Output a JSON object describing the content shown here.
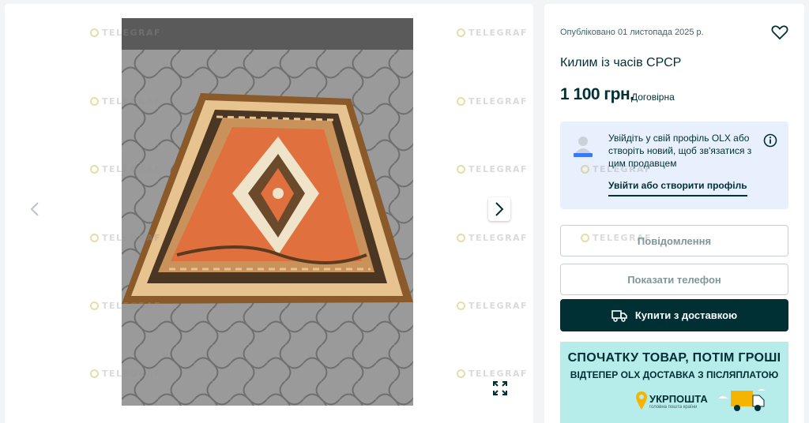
{
  "gallery": {
    "image_alt": "carpet photo",
    "prev_icon": "chevron-left-icon",
    "next_icon": "chevron-right-icon",
    "fullscreen_icon": "expand-icon",
    "watermark": "TELEGRAF"
  },
  "listing": {
    "published": "Опубліковано 01 листопада 2025 р.",
    "title": "Килим із часів СРСР",
    "price": "1 100 грн.",
    "negotiable": "Договірна",
    "favorite_icon": "heart-icon"
  },
  "login_prompt": {
    "text": "Увійдіть у свій профіль OLX або створіть новий, щоб зв'язатися з цим продавцем",
    "link": "Увійти або створити профіль",
    "info_icon": "info-icon"
  },
  "actions": {
    "message": "Повідомлення",
    "show_phone": "Показати телефон",
    "buy_delivery": "Купити з доставкою",
    "buy_icon": "truck-icon"
  },
  "banner": {
    "headline": "СПОЧАТКУ ТОВАР, ПОТІМ ГРОШІ",
    "subline": "ВІДТЕПЕР OLX ДОСТАВКА З ПІСЛЯПЛАТОЮ",
    "brand": "УКРПОШТА",
    "tagline": "головна пошта країни"
  },
  "colors": {
    "primary": "#002f34",
    "login_bg": "#e8f0fe",
    "banner_bg": "#b6ece9",
    "carpet_field": "#e0703d"
  }
}
